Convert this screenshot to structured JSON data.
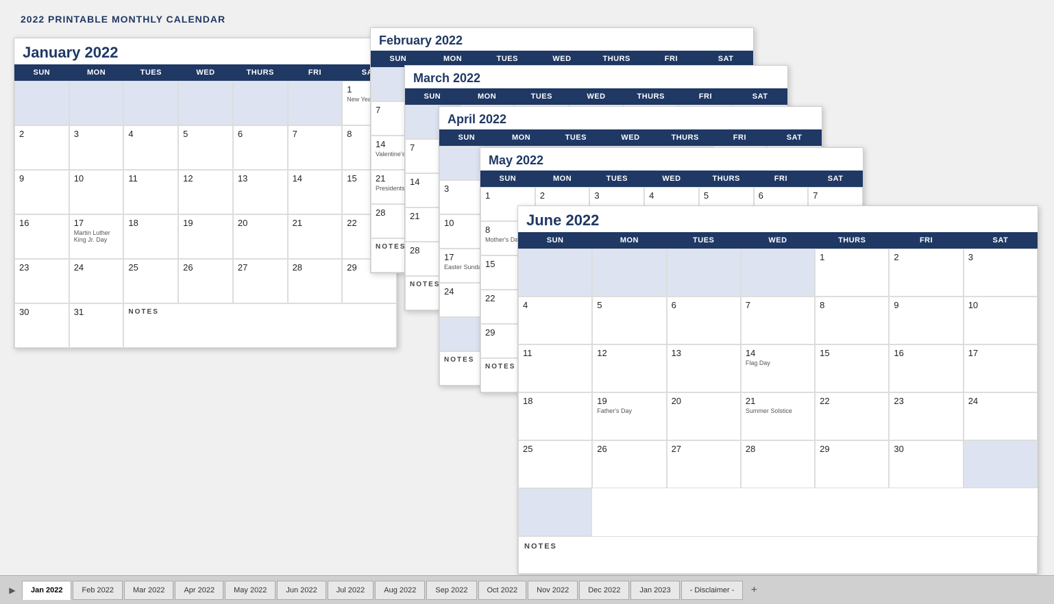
{
  "page": {
    "title": "2022 PRINTABLE MONTHLY CALENDAR"
  },
  "calendars": {
    "january": {
      "title": "January 2022",
      "headers": [
        "SUN",
        "MON",
        "TUES",
        "WED",
        "THURS",
        "FRI",
        "SAT"
      ],
      "notes_label": "NOTES"
    },
    "february": {
      "title": "February 2022",
      "headers": [
        "SUN",
        "MON",
        "TUES",
        "WED",
        "THURS",
        "FRI",
        "SAT"
      ]
    },
    "march": {
      "title": "March 2022",
      "headers": [
        "SUN",
        "MON",
        "TUES",
        "WED",
        "THURS",
        "FRI",
        "SAT"
      ]
    },
    "april": {
      "title": "April 2022",
      "headers": [
        "SUN",
        "MON",
        "TUES",
        "WED",
        "THURS",
        "FRI",
        "SAT"
      ]
    },
    "may": {
      "title": "May 2022",
      "headers": [
        "SUN",
        "MON",
        "TUES",
        "WED",
        "THURS",
        "FRI",
        "SAT"
      ]
    },
    "june": {
      "title": "June 2022",
      "headers": [
        "SUN",
        "MON",
        "TUES",
        "WED",
        "THURS",
        "FRI",
        "SAT"
      ],
      "notes_label": "NOTES"
    }
  },
  "tabs": [
    {
      "label": "Jan 2022",
      "active": true
    },
    {
      "label": "Feb 2022",
      "active": false
    },
    {
      "label": "Mar 2022",
      "active": false
    },
    {
      "label": "Apr 2022",
      "active": false
    },
    {
      "label": "May 2022",
      "active": false
    },
    {
      "label": "Jun 2022",
      "active": false
    },
    {
      "label": "Jul 2022",
      "active": false
    },
    {
      "label": "Aug 2022",
      "active": false
    },
    {
      "label": "Sep 2022",
      "active": false
    },
    {
      "label": "Oct 2022",
      "active": false
    },
    {
      "label": "Nov 2022",
      "active": false
    },
    {
      "label": "Dec 2022",
      "active": false
    },
    {
      "label": "Jan 2023",
      "active": false
    },
    {
      "label": "- Disclaimer -",
      "active": false
    }
  ]
}
